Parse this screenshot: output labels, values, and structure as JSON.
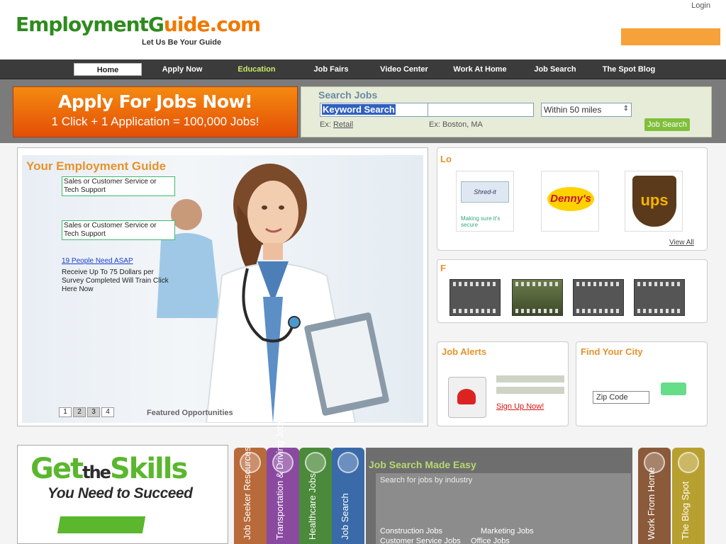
{
  "header": {
    "logo_part1": "EmploymentG",
    "logo_part2": "uide.com",
    "tagline_prefix": "",
    "tagline": "Let Us Be Your Guide",
    "login": "Login",
    "promo_heading": ""
  },
  "nav": {
    "items": [
      {
        "label": "Home"
      },
      {
        "label": "Apply Now"
      },
      {
        "label": "Education"
      },
      {
        "label": "Job Fairs"
      },
      {
        "label": "Video Center"
      },
      {
        "label": "Work At Home"
      },
      {
        "label": "Job Search"
      },
      {
        "label": "The Spot Blog"
      }
    ]
  },
  "apply_banner": {
    "title": "Apply For Jobs Now!",
    "subtitle": "1 Click + 1 Application = 100,000 Jobs!"
  },
  "search": {
    "title": "Search Jobs",
    "keyword_value": "Keyword Search",
    "example1_prefix": "Ex:",
    "example1": "Retail",
    "example2_prefix": "Ex:",
    "example2": "Boston, MA",
    "radius": "Within 50 miles",
    "or_label": "",
    "submit": "Job Search"
  },
  "feature": {
    "title": "Your Employment Guide",
    "links": [
      {
        "text": "Sales or Customer Service or Tech Support"
      },
      {
        "text": "Sales or Customer Service or Tech Support"
      },
      {
        "text": "19 People Need ASAP"
      },
      {
        "text": "Receive Up To 75 Dollars per Survey Completed Will Train Click Here Now"
      }
    ],
    "pages": [
      "1",
      "2",
      "3",
      "4"
    ],
    "featured": "Featured Opportunities"
  },
  "employers": {
    "heading": "Lo",
    "shred_label": "Shred-it",
    "shred_caption": "Making sure it's secure",
    "dennys": "Denny's",
    "ups": "ups",
    "view_all": "View All"
  },
  "videos": {
    "heading": "F"
  },
  "job_alerts": {
    "heading": "Job Alerts",
    "signup": "Sign Up Now!"
  },
  "city": {
    "heading": "Find Your City",
    "zip_placeholder": "Zip Code"
  },
  "skills": {
    "line1_a": "Get",
    "line1_b": "the",
    "line1_c": "Skills",
    "line2": "You Need to Succeed"
  },
  "tabs": [
    {
      "label": "Job Seeker Resources",
      "color": "#b86a3a"
    },
    {
      "label": "Transportation & Driving Jobs",
      "color": "#8a4aa0"
    },
    {
      "label": "Healthcare Jobs",
      "color": "#4a8a3a"
    },
    {
      "label": "Job Search",
      "color": "#3a6aa8"
    },
    {
      "label": "Work From Home",
      "color": "#8a5a3a"
    },
    {
      "label": "The Blog Spot",
      "color": "#b8a030"
    }
  ],
  "job_made_easy": {
    "title": "Job Search Made Easy",
    "intro": "Search for jobs by industry",
    "links": [
      "Construction Jobs",
      "Marketing Jobs",
      "Customer Service Jobs",
      "Office Jobs"
    ]
  }
}
